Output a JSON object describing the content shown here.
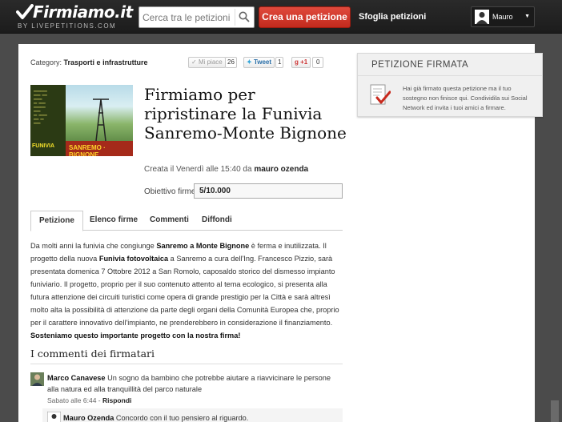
{
  "header": {
    "logo_text": "Firmiamo.it",
    "logo_sub": "BY LIVEPETITIONS.COM",
    "search_placeholder": "Cerca tra le petizioni",
    "create_button": "Crea una petizione",
    "browse_link": "Sfoglia petizioni",
    "user_name": "Mauro",
    "user_caret": "▼"
  },
  "category": {
    "label": "Category:",
    "value": "Trasporti e infrastrutture"
  },
  "social": {
    "like_label": "Mi piace",
    "like_count": "26",
    "tweet_label": "Tweet",
    "tweet_count": "1",
    "gplus_label": "+1",
    "gplus_count": "0"
  },
  "petition": {
    "title": "Firmiamo per ripristinare la Funivia Sanremo-Monte Bignone",
    "created_prefix": "Creata il Venerdì alle 15:40 da",
    "author": "mauro ozenda",
    "goal_label": "Obiettivo firme:",
    "goal_value": "5/10.000"
  },
  "thumbnail": {
    "funivia_text": "FUNIVIA",
    "bottom_text": "SANREMO · BIGNONE"
  },
  "tabs": [
    "Petizione",
    "Elenco firme",
    "Commenti",
    "Diffondi"
  ],
  "body": {
    "p1": "Da molti anni la funivia che congiunge",
    "p1b": "Sanremo a Monte Bignone",
    "p2": "è ferma e inutilizzata. Il progetto della nuova",
    "p2b": "Funivia fotovoltaica",
    "p3": "a Sanremo a cura dell'Ing. Francesco Pizzio, sarà presentata domenica 7 Ottobre 2012 a San Romolo, caposaldo storico del dismesso impianto funiviario.  Il progetto, proprio per il suo contenuto attento al tema ecologico, si presenta alla futura attenzione dei circuiti turistici come opera di grande prestigio per la Città e sarà altresì molto alta la possibilità di attenzione da parte degli organi della Comunità Europea che, proprio per il carattere innovativo dell'impianto, ne prenderebbero in considerazione il finanziamento.",
    "closing": "Sosteniamo questo importante progetto con la nostra firma!"
  },
  "comments": {
    "title": "I commenti dei firmatari",
    "items": [
      {
        "author": "Marco Canavese",
        "text": "Un sogno da bambino che potrebbe aiutare a riavvicinare le persone alla natura ed alla tranquillità del parco naturale",
        "time": "Sabato alle 6:44 -",
        "reply": "Rispondi"
      }
    ],
    "reply": {
      "author": "Mauro Ozenda",
      "text": "Concordo con il tuo pensiero al riguardo."
    }
  },
  "signed_box": {
    "title": "PETIZIONE FIRMATA",
    "text": "Hai già firmato questa petizione ma il tuo sostegno non finisce qui. Condividila sui Social Network ed invita i tuoi amici a firmare."
  },
  "colors": {
    "accent_red": "#d0352a",
    "topbar": "#222222",
    "background": "#4b4b4b"
  }
}
